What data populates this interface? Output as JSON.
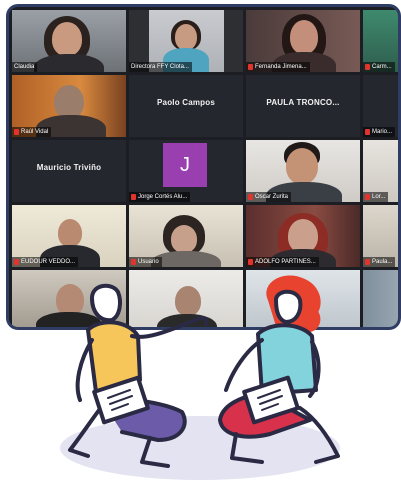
{
  "participants": [
    {
      "name": "Claudia"
    },
    {
      "name": "Directora FFY Clota..."
    },
    {
      "name": "Fernanda Jimena..."
    },
    {
      "name": "Carm..."
    },
    {
      "name": "Raúl Vidal"
    },
    {
      "name": "Paolo Campos"
    },
    {
      "name": "PAULA TRONCO..."
    },
    {
      "name": "Mario..."
    },
    {
      "name": "Mauricio Triviño"
    },
    {
      "name": "Jorge Cortés Alu..."
    },
    {
      "name": "Oscar Zurita"
    },
    {
      "name": "Lor..."
    },
    {
      "name": "EUDOUR VEDDO..."
    },
    {
      "name": "Usuario"
    },
    {
      "name": "ADOLFO PARTINES..."
    },
    {
      "name": "Paula..."
    }
  ],
  "avatar_letter": "J",
  "colors": {
    "frame_border": "#2f3c63",
    "mic_off": "#e1342f",
    "avatar_bg": "#9a3fb0",
    "active_speaker": "#e5c84a",
    "person_yellow_shirt": "#f6c65b",
    "person_teal_shirt": "#82d3dc",
    "person_red_hair": "#e7432e",
    "purple_pants": "#6c5ba8",
    "red_pants": "#d8314c",
    "cushion": "#e4e3f1"
  }
}
